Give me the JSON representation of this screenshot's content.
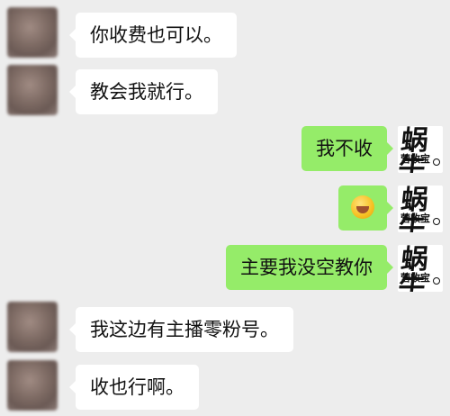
{
  "contact_messages": [
    {
      "text": "你收费也可以。"
    },
    {
      "text": "教会我就行。"
    }
  ],
  "my_messages": [
    {
      "text": "我不收"
    },
    {
      "text": "",
      "emoji": "grinning-face-emoji"
    },
    {
      "text": "主要我没空教你"
    }
  ],
  "contact_messages_2": [
    {
      "text": "我这边有主播零粉号。"
    },
    {
      "text": "收也行啊。"
    }
  ],
  "my_avatar": {
    "logo_main": "蜗牛",
    "logo_sub": "营收宝"
  },
  "colors": {
    "background": "#ededed",
    "incoming_bubble": "#ffffff",
    "outgoing_bubble": "#95ec69"
  }
}
